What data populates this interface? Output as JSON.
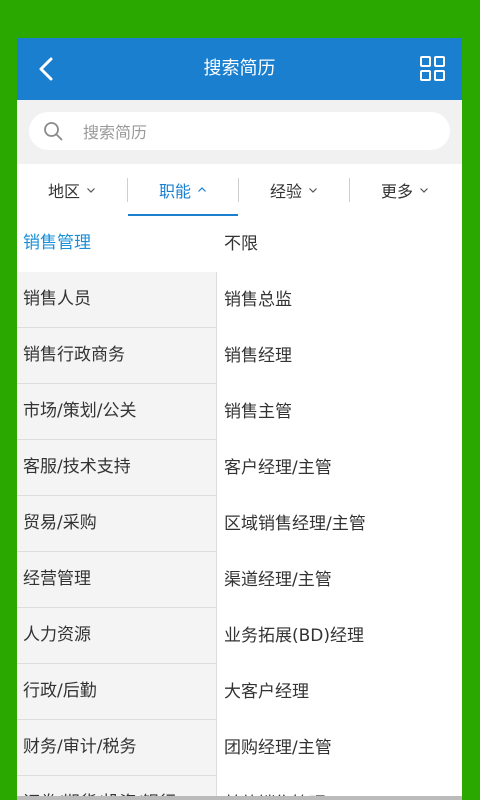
{
  "header": {
    "title": "搜索简历",
    "back_icon": "chevron-left-icon",
    "grid_icon": "grid-icon"
  },
  "search": {
    "placeholder": "搜索简历",
    "value": ""
  },
  "filters": [
    {
      "label": "地区",
      "active": false
    },
    {
      "label": "职能",
      "active": true
    },
    {
      "label": "经验",
      "active": false
    },
    {
      "label": "更多",
      "active": false
    }
  ],
  "categories": [
    "销售管理",
    "销售人员",
    "销售行政商务",
    "市场/策划/公关",
    "客服/技术支持",
    "贸易/采购",
    "经营管理",
    "人力资源",
    "行政/后勤",
    "财务/审计/税务",
    "证券/期货/投资/银行"
  ],
  "subcategories": [
    "不限",
    "销售总监",
    "销售经理",
    "销售主管",
    "客户经理/主管",
    "区域销售经理/主管",
    "渠道经理/主管",
    "业务拓展(BD)经理",
    "大客户经理",
    "团购经理/主管",
    "其他销售管理"
  ],
  "colors": {
    "accent": "#1a7fcf",
    "active_category": "#1a8fd8",
    "outer_background": "#2aa800"
  }
}
